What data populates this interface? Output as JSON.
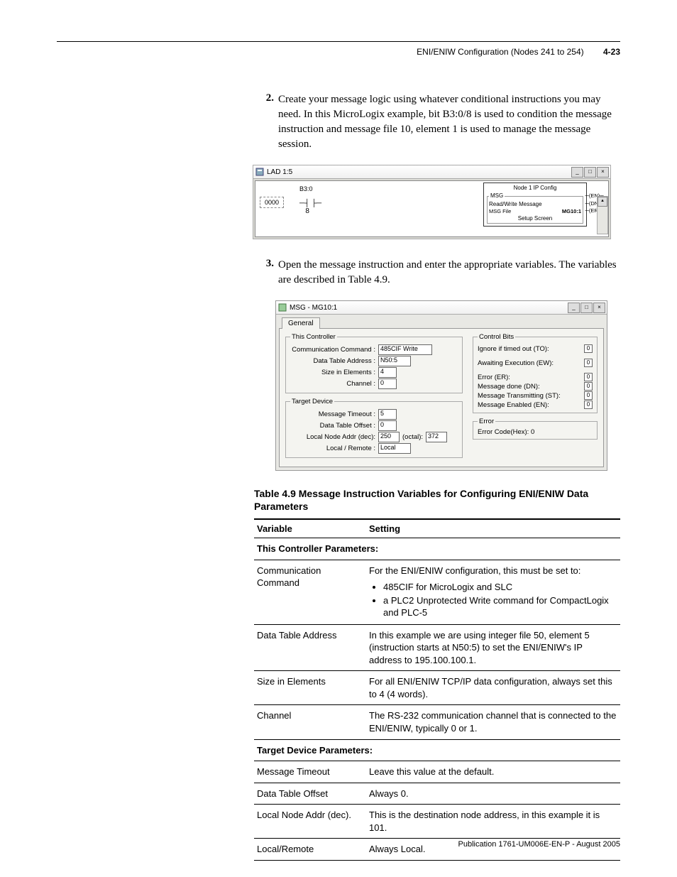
{
  "header": {
    "section": "ENI/ENIW Configuration (Nodes 241 to 254)",
    "page": "4-23"
  },
  "steps": [
    {
      "num": "2.",
      "text": "Create your message logic using whatever conditional instructions you may need. In this MicroLogix example, bit B3:0/8 is used to condition the message instruction and message file 10, element 1 is used to manage the message session."
    },
    {
      "num": "3.",
      "text": "Open the message instruction and enter the appropriate variables. The variables are described in Table 4.9."
    }
  ],
  "fig1": {
    "title": "LAD 1:5",
    "rung": "0000",
    "contact": "B3:0",
    "bitnum": "8",
    "msg_title": "Node 1 IP Config",
    "msg_group": "MSG",
    "rw": "Read/Write Message",
    "file_lbl": "MSG File",
    "file_val": "MG10:1",
    "setup": "Setup Screen",
    "outs": [
      "EN",
      "DN",
      "ER"
    ]
  },
  "fig2": {
    "title": "MSG - MG10:1",
    "tab": "General",
    "grp_this": "This Controller",
    "this_rows": [
      {
        "label": "Communication Command :",
        "value": "485CIF Write"
      },
      {
        "label": "Data Table Address :",
        "value": "N50:5"
      },
      {
        "label": "Size in Elements :",
        "value": "4"
      },
      {
        "label": "Channel :",
        "value": "0"
      }
    ],
    "grp_target": "Target Device",
    "target_rows": [
      {
        "label": "Message Timeout :",
        "value": "5"
      },
      {
        "label": "Data Table Offset :",
        "value": "0"
      }
    ],
    "lna_label": "Local Node Addr (dec):",
    "lna_dec": "250",
    "lna_octlbl": "(octal):",
    "lna_oct": "372",
    "lr_label": "Local / Remote :",
    "lr_value": "Local",
    "grp_ctrl": "Control Bits",
    "ctrl_rows": [
      {
        "label": "Ignore if timed out (TO):",
        "val": "0"
      },
      {
        "label": "Awaiting Execution (EW):",
        "val": "0"
      },
      {
        "label": "Error (ER):",
        "val": "0"
      },
      {
        "label": "Message done (DN):",
        "val": "0"
      },
      {
        "label": "Message Transmitting (ST):",
        "val": "0"
      },
      {
        "label": "Message Enabled (EN):",
        "val": "0"
      }
    ],
    "grp_err": "Error",
    "err_text": "Error Code(Hex): 0"
  },
  "table": {
    "caption": "Table 4.9 Message Instruction Variables for Configuring ENI/ENIW Data Parameters",
    "h1": "Variable",
    "h2": "Setting",
    "sub1": "This Controller Parameters:",
    "rows1": [
      {
        "v": "Communication Command",
        "s_lead": "For the ENI/ENIW configuration, this must be set to:",
        "b1": "485CIF for MicroLogix and SLC",
        "b2": "a PLC2 Unprotected Write command for CompactLogix and PLC-5"
      },
      {
        "v": "Data Table Address",
        "s": "In this example we are using integer file 50, element 5 (instruction starts at N50:5) to set the ENI/ENIW's IP address to 195.100.100.1."
      },
      {
        "v": "Size in Elements",
        "s": "For all ENI/ENIW TCP/IP data configuration, always set this to 4 (4 words)."
      },
      {
        "v": "Channel",
        "s": "The RS-232 communication channel that is connected to the ENI/ENIW, typically 0 or 1."
      }
    ],
    "sub2": "Target Device Parameters:",
    "rows2": [
      {
        "v": "Message Timeout",
        "s": "Leave this value at the default."
      },
      {
        "v": "Data Table Offset",
        "s": "Always 0."
      },
      {
        "v": "Local Node Addr (dec).",
        "s": "This is the destination node address, in this example it is 101."
      },
      {
        "v": "Local/Remote",
        "s": "Always Local."
      }
    ]
  },
  "footer": "Publication 1761-UM006E-EN-P - August 2005"
}
